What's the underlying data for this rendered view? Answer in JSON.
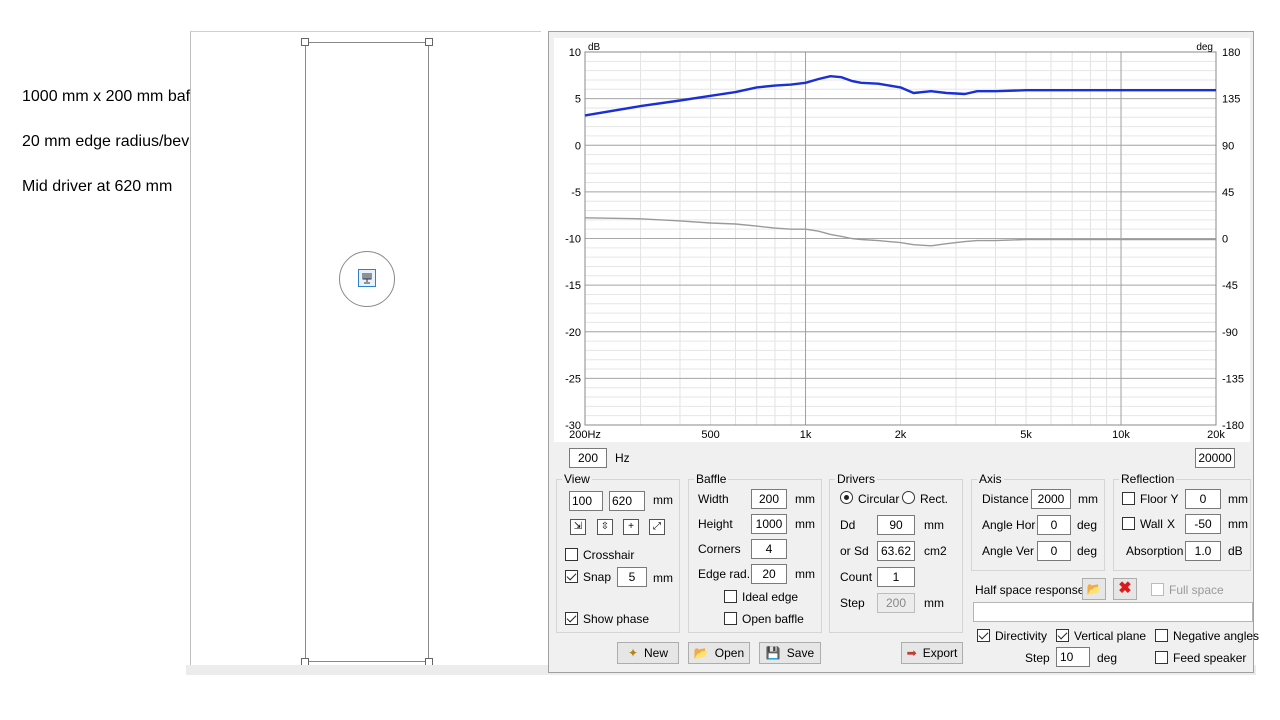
{
  "notes": [
    "1000 mm x 200 mm baffle",
    "20 mm edge radius/bevel",
    "Mid driver at 620 mm"
  ],
  "chart_data": {
    "type": "line",
    "ylabel_left": "dB",
    "ylabel_right": "deg",
    "y_left_ticks": [
      "10",
      "5",
      "0",
      "-5",
      "-10",
      "-15",
      "-20",
      "-25",
      "-30"
    ],
    "y_right_ticks": [
      "180",
      "135",
      "90",
      "45",
      "0",
      "-45",
      "-90",
      "-135",
      "-180"
    ],
    "x_ticks": [
      "200Hz",
      "500",
      "1k",
      "2k",
      "5k",
      "10k",
      "20k"
    ],
    "x_tick_values": [
      200,
      500,
      1000,
      2000,
      5000,
      10000,
      20000
    ],
    "xlim": [
      200,
      20000
    ],
    "ylim_left": [
      -30,
      10
    ],
    "ylim_right": [
      -180,
      180
    ],
    "x_scale": "log",
    "grid": true,
    "series": [
      {
        "color": "#1a2fd8",
        "axis": "left",
        "x": [
          200,
          300,
          400,
          500,
          600,
          700,
          800,
          900,
          1000,
          1100,
          1200,
          1300,
          1400,
          1500,
          1700,
          2000,
          2200,
          2500,
          2800,
          3200,
          3500,
          4000,
          5000,
          6000,
          8000,
          10000,
          15000,
          20000
        ],
        "y": [
          3.2,
          4.2,
          4.8,
          5.3,
          5.7,
          6.2,
          6.4,
          6.5,
          6.7,
          7.1,
          7.4,
          7.3,
          6.9,
          6.7,
          6.6,
          6.2,
          5.6,
          5.8,
          5.6,
          5.5,
          5.8,
          5.8,
          5.9,
          5.9,
          5.9,
          5.9,
          5.9,
          5.9
        ]
      },
      {
        "color": "#9a9a9a",
        "axis": "right",
        "x": [
          200,
          300,
          400,
          500,
          600,
          700,
          800,
          900,
          1000,
          1100,
          1200,
          1300,
          1400,
          1500,
          1700,
          2000,
          2200,
          2500,
          2800,
          3200,
          3500,
          4000,
          5000,
          6000,
          8000,
          10000,
          15000,
          20000
        ],
        "y": [
          20,
          19,
          17,
          15,
          14,
          12,
          10,
          9,
          9,
          7,
          4,
          2,
          0,
          -1,
          -2,
          -4,
          -6,
          -7,
          -5,
          -3,
          -2,
          -2,
          -1,
          -1,
          -1,
          -1,
          -1,
          -1
        ]
      }
    ]
  },
  "freq": {
    "min": "200",
    "max": "20000",
    "unit": "Hz"
  },
  "view": {
    "title": "View",
    "x": "100",
    "y": "620",
    "unit": "mm",
    "crosshair": "Crosshair",
    "snap": "Snap",
    "snap_value": "5",
    "show_phase": "Show phase"
  },
  "baffle": {
    "title": "Baffle",
    "width_label": "Width",
    "width": "200",
    "height_label": "Height",
    "height": "1000",
    "corners_label": "Corners",
    "corners": "4",
    "edge_label": "Edge rad.",
    "edge": "20",
    "ideal_edge": "Ideal edge",
    "open_baffle": "Open baffle",
    "unit": "mm"
  },
  "drivers": {
    "title": "Drivers",
    "circular": "Circular",
    "rect": "Rect.",
    "dd_label": "Dd",
    "dd": "90",
    "dd_unit": "mm",
    "sd_label": "or Sd",
    "sd": "63.62",
    "sd_unit": "cm2",
    "count_label": "Count",
    "count": "1",
    "step_label": "Step",
    "step": "200",
    "step_unit": "mm"
  },
  "axis": {
    "title": "Axis",
    "distance_label": "Distance",
    "distance": "2000",
    "distance_unit": "mm",
    "hor_label": "Angle Hor",
    "hor": "0",
    "ver_label": "Angle Ver",
    "ver": "0",
    "deg": "deg"
  },
  "reflection": {
    "title": "Reflection",
    "floor_label": "Floor Y",
    "floor": "0",
    "wall_label": "Wall",
    "wall_x": "X",
    "wall": "-50",
    "unit": "mm",
    "absorption_label": "Absorption",
    "absorption": "1.0",
    "absorption_unit": "dB"
  },
  "halfspace": {
    "label": "Half space response",
    "full_space": "Full space"
  },
  "options": {
    "directivity": "Directivity",
    "vertical_plane": "Vertical plane",
    "negative_angles": "Negative angles",
    "step_label": "Step",
    "step": "10",
    "step_unit": "deg",
    "feed_speaker": "Feed speaker"
  },
  "buttons": {
    "new": "New",
    "open": "Open",
    "save": "Save",
    "export": "Export"
  }
}
